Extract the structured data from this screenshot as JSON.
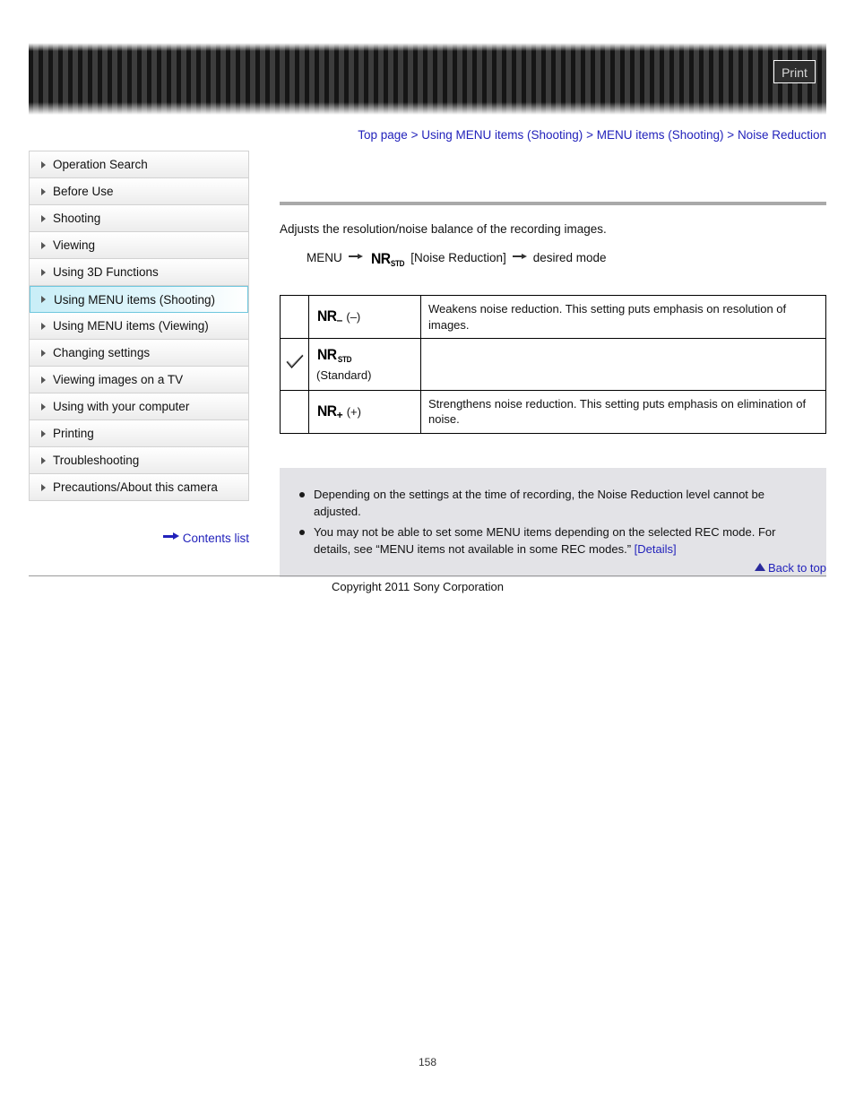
{
  "header": {
    "print_label": "Print"
  },
  "breadcrumb": {
    "items": [
      {
        "label": "Top page"
      },
      {
        "label": "Using MENU items (Shooting)"
      },
      {
        "label": "MENU items (Shooting)"
      },
      {
        "label": "Noise Reduction"
      }
    ],
    "separator": ">"
  },
  "sidebar": {
    "items": [
      {
        "label": "Operation Search",
        "active": false
      },
      {
        "label": "Before Use",
        "active": false
      },
      {
        "label": "Shooting",
        "active": false
      },
      {
        "label": "Viewing",
        "active": false
      },
      {
        "label": "Using 3D Functions",
        "active": false
      },
      {
        "label": "Using MENU items (Shooting)",
        "active": true
      },
      {
        "label": "Using MENU items (Viewing)",
        "active": false
      },
      {
        "label": "Changing settings",
        "active": false
      },
      {
        "label": "Viewing images on a TV",
        "active": false
      },
      {
        "label": "Using with your computer",
        "active": false
      },
      {
        "label": "Printing",
        "active": false
      },
      {
        "label": "Troubleshooting",
        "active": false
      },
      {
        "label": "Precautions/About this camera",
        "active": false
      }
    ],
    "contents_list_label": "Contents list"
  },
  "main": {
    "intro": "Adjusts the resolution/noise balance of the recording images.",
    "menu_path": {
      "start": "MENU",
      "icon_main": "NR",
      "icon_sub": "STD",
      "middle": "[Noise Reduction]",
      "end": "desired mode"
    },
    "table": {
      "rows": [
        {
          "checked": "",
          "icon_main": "NR",
          "icon_sign": "–",
          "icon_sub": "",
          "icon_suffix": "(–)",
          "sub_label": "",
          "description": "Weakens noise reduction. This setting puts emphasis on resolution of images."
        },
        {
          "checked": "check-icon",
          "icon_main": "NR",
          "icon_sign": "",
          "icon_sub": "STD",
          "icon_suffix": "",
          "sub_label": "(Standard)",
          "description": ""
        },
        {
          "checked": "",
          "icon_main": "NR",
          "icon_sign": "+",
          "icon_sub": "",
          "icon_suffix": "(+)",
          "sub_label": "",
          "description": "Strengthens noise reduction. This setting puts emphasis on elimination of noise."
        }
      ]
    },
    "notes": [
      {
        "text": "Depending on the settings at the time of recording, the Noise Reduction level cannot be adjusted.",
        "link": ""
      },
      {
        "text": "You may not be able to set some MENU items depending on the selected REC mode. For details, see “MENU items not available in some REC modes.”",
        "link": "[Details]"
      }
    ]
  },
  "footer": {
    "back_to_top_label": "Back to top",
    "copyright": "Copyright 2011 Sony Corporation",
    "page_number": "158"
  },
  "colors": {
    "link": "#2222bb",
    "accent_active_border": "#6ec7de",
    "notes_bg": "#e3e3e7",
    "rule": "#a9a9a9"
  }
}
